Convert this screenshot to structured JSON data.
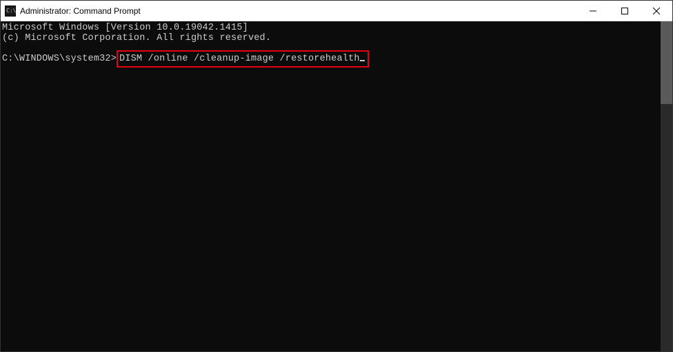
{
  "window": {
    "title": "Administrator: Command Prompt"
  },
  "terminal": {
    "line1": "Microsoft Windows [Version 10.0.19042.1415]",
    "line2": "(c) Microsoft Corporation. All rights reserved.",
    "prompt": "C:\\WINDOWS\\system32>",
    "command": "DISM /online /cleanup-image /restorehealth"
  }
}
